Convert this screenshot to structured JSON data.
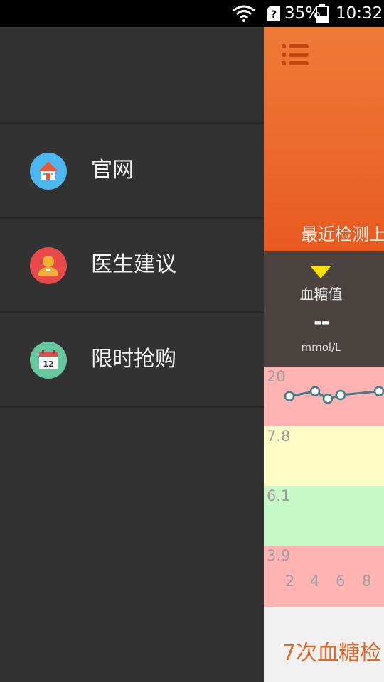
{
  "status_bar": {
    "battery": "35%",
    "time": "10:32"
  },
  "drawer": {
    "items": [
      {
        "label": "官网",
        "icon": "home-icon",
        "color": "#4cb7ee"
      },
      {
        "label": "医生建议",
        "icon": "doctor-icon",
        "color": "#e84a4a"
      },
      {
        "label": "限时抢购",
        "icon": "calendar-icon",
        "color": "#66c7a1",
        "icon_text": "12"
      }
    ]
  },
  "main": {
    "recent_text": "最近检测上",
    "reading": {
      "name": "血糖值",
      "value": "--",
      "unit": "mmol/L"
    },
    "footer_text": "7次血糖检"
  },
  "chart_data": {
    "type": "line",
    "band_labels": [
      "20",
      "7.8",
      "6.1",
      "3.9"
    ],
    "x_ticks": [
      "2",
      "4",
      "6",
      "8"
    ],
    "band_colors": [
      "#ffb3b3",
      "#fffcc6",
      "#c8f7c8",
      "#ffb3b3"
    ],
    "points": [
      {
        "x": 1,
        "y": 11.5
      },
      {
        "x": 3,
        "y": 13.5
      },
      {
        "x": 4,
        "y": 10.5
      },
      {
        "x": 5,
        "y": 12.0
      },
      {
        "x": 8,
        "y": 13.5
      },
      {
        "x": 9,
        "y": 13.0
      }
    ]
  }
}
